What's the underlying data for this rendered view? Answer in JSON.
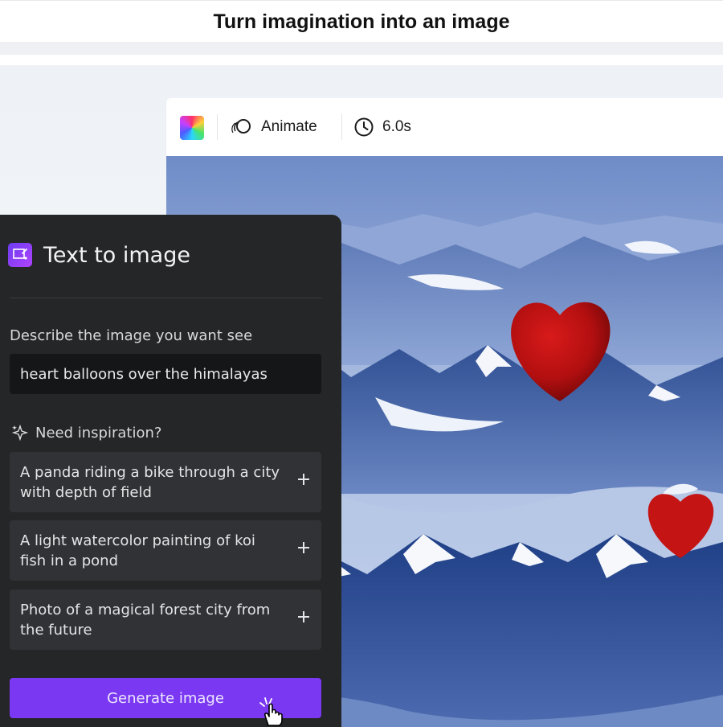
{
  "caption": "Turn imagination into an image",
  "toolbar": {
    "animate_label": "Animate",
    "duration": "6.0s",
    "icons": [
      "color-swatch",
      "animate-icon",
      "clock-icon"
    ]
  },
  "panel": {
    "title": "Text to image",
    "field_label": "Describe the image you want see",
    "prompt_value": "heart balloons over the himalayas",
    "inspiration_label": "Need inspiration?",
    "suggestions": [
      {
        "text": "A panda riding a bike through a city with depth of field"
      },
      {
        "text": "A light watercolor painting of koi fish in a pond"
      },
      {
        "text": "Photo of a magical forest city from the future"
      }
    ],
    "generate_label": "Generate image"
  },
  "colors": {
    "panel_bg": "#252627",
    "input_bg": "#151617",
    "suggestion_bg": "#313235",
    "accent": "#7b38f2"
  }
}
